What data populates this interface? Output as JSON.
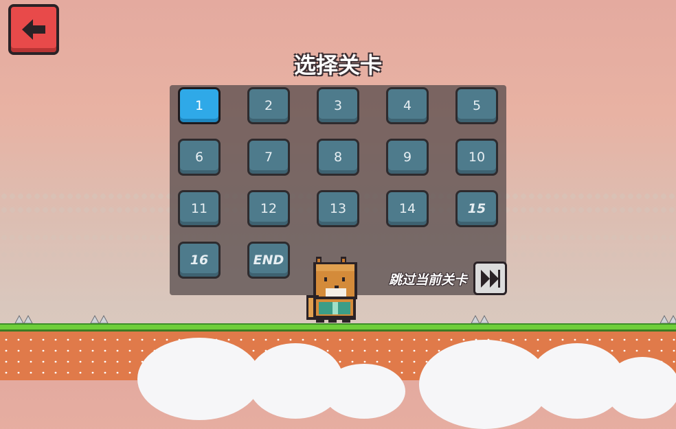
{
  "header": {
    "title": "选择关卡",
    "back_icon": "arrow-left-icon"
  },
  "levels": [
    {
      "label": "1",
      "selected": true
    },
    {
      "label": "2"
    },
    {
      "label": "3"
    },
    {
      "label": "4"
    },
    {
      "label": "5"
    },
    {
      "label": "6"
    },
    {
      "label": "7"
    },
    {
      "label": "8"
    },
    {
      "label": "9"
    },
    {
      "label": "10"
    },
    {
      "label": "11"
    },
    {
      "label": "12"
    },
    {
      "label": "13"
    },
    {
      "label": "14"
    },
    {
      "label": "15"
    },
    {
      "label": "16"
    },
    {
      "label": "END"
    }
  ],
  "skip": {
    "label": "跳过当前关卡",
    "icon": "fast-forward-icon"
  },
  "colors": {
    "selected": "#2fa9e8",
    "level": "#4e7b8c",
    "back": "#e84a4a",
    "grass": "#6fce3a",
    "dirt": "#e07a4a"
  }
}
